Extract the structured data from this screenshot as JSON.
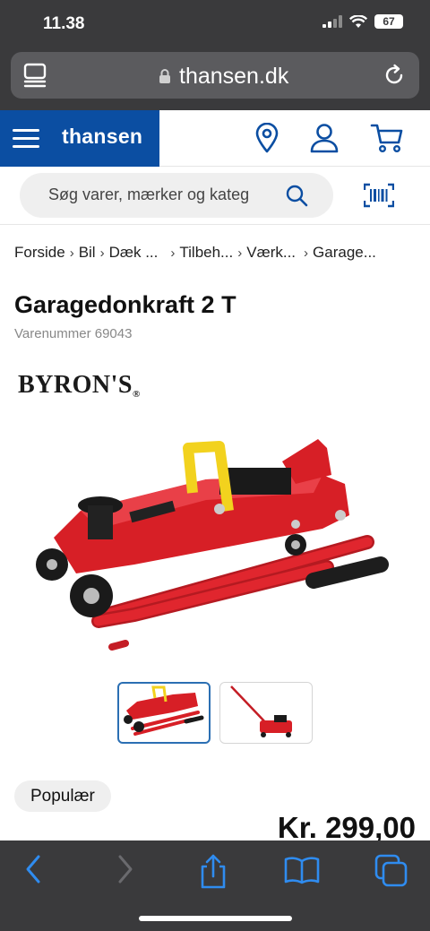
{
  "status": {
    "time": "11.38",
    "battery": "67"
  },
  "browser": {
    "url": "thansen.dk"
  },
  "header": {
    "logo": "thansen"
  },
  "search": {
    "placeholder": "Søg varer, mærker og kateg"
  },
  "breadcrumb": [
    "Forside",
    "Bil",
    "Dæk ...",
    "Tilbeh...",
    "Værk...",
    "Garage..."
  ],
  "product": {
    "title": "Garagedonkraft 2 T",
    "sku": "Varenummer 69043",
    "brand": "BYRON'S",
    "brand_mark": "®",
    "badge": "Populær",
    "price": "Kr. 299,00"
  },
  "colors": {
    "brand_blue": "#0b4ea2",
    "ios_blue": "#2f8cf0",
    "jack_red": "#d71f26"
  },
  "icons": [
    "tab-switcher-icon",
    "lock-icon",
    "reload-icon",
    "menu-icon",
    "location-pin-icon",
    "user-icon",
    "cart-icon",
    "search-icon",
    "barcode-scanner-icon",
    "back-icon",
    "forward-icon",
    "share-icon",
    "bookmarks-icon",
    "tabs-icon"
  ]
}
